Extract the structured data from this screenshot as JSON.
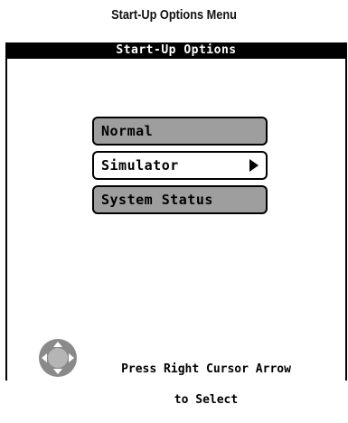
{
  "caption": "Start-Up Options Menu",
  "screen": {
    "title": "Start-Up Options",
    "menu": [
      {
        "label": "Normal",
        "selected": false
      },
      {
        "label": "Simulator",
        "selected": true
      },
      {
        "label": "System Status",
        "selected": false
      }
    ],
    "hint_line1": "Press Right Cursor Arrow",
    "hint_line2": "to Select",
    "dpad_icon": "four-way-cursor-pad-icon"
  },
  "colors": {
    "unselected_item": "#9e9e9e",
    "selected_item": "#ffffff",
    "title_bar": "#000000"
  }
}
